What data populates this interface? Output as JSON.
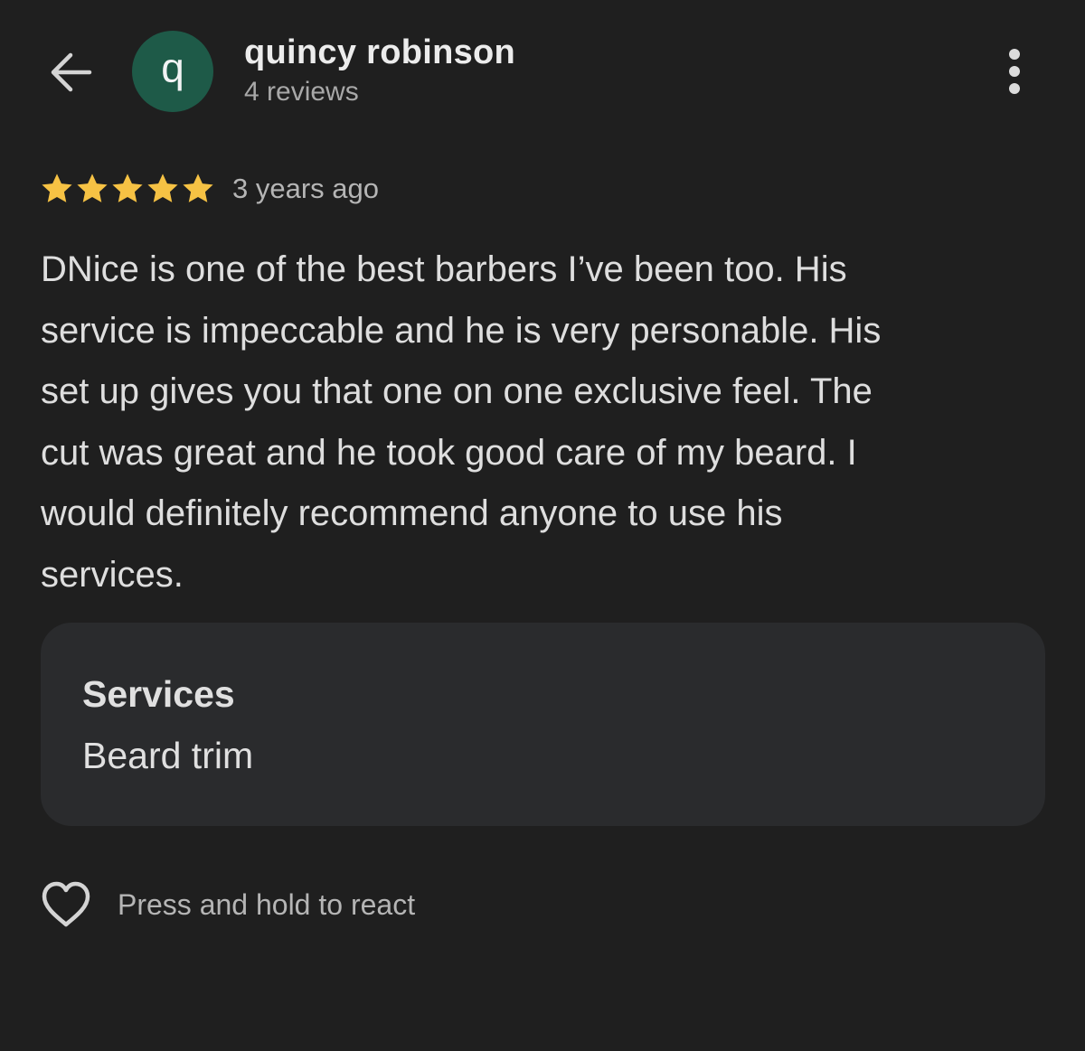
{
  "header": {
    "back_icon": "arrow-left-icon",
    "avatar_letter": "q",
    "avatar_color": "#1e5a48",
    "user_name": "quincy robinson",
    "review_count": "4 reviews",
    "more_icon": "more-vertical-icon"
  },
  "review": {
    "rating": 5,
    "rating_max": 5,
    "star_color": "#f6c244",
    "time_ago": "3 years ago",
    "text": "DNice is one of the best barbers I’ve been too. His\nservice is impeccable and he is very personable. His\nset up gives you that one on one exclusive feel. The\ncut was great and he took good care of my beard. I\nwould definitely recommend anyone to use his\nservices."
  },
  "services": {
    "heading": "Services",
    "value": "Beard trim"
  },
  "reaction": {
    "icon": "heart-outline-icon",
    "label": "Press and hold to react"
  }
}
